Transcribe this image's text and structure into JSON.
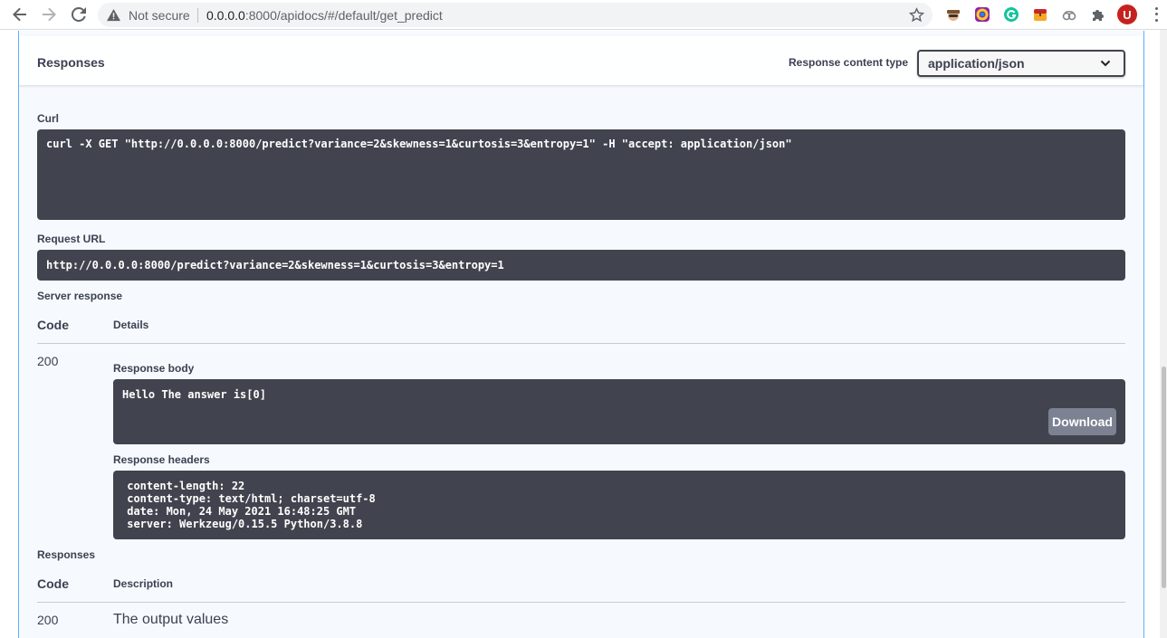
{
  "browser": {
    "security_label": "Not secure",
    "url_host": "0.0.0.0",
    "url_rest": ":8000/apidocs/#/default/get_predict",
    "avatar_letter": "U",
    "extension_icons": [
      "incognito-spy-icon",
      "colorful-circle-icon",
      "grammarly-icon",
      "treasure-chest-icon",
      "cloud-link-icon",
      "puzzle-extensions-icon"
    ]
  },
  "responses_header": {
    "title": "Responses",
    "content_type_label": "Response content type",
    "content_type_value": "application/json"
  },
  "curl": {
    "label": "Curl",
    "command": "curl -X GET \"http://0.0.0.0:8000/predict?variance=2&skewness=1&curtosis=3&entropy=1\" -H \"accept: application/json\""
  },
  "request_url": {
    "label": "Request URL",
    "value": "http://0.0.0.0:8000/predict?variance=2&skewness=1&curtosis=3&entropy=1"
  },
  "server_response": {
    "label": "Server response",
    "col_code": "Code",
    "col_details": "Details",
    "code": "200",
    "body_label": "Response body",
    "body": "Hello The answer is[0]",
    "download_label": "Download",
    "headers_label": "Response headers",
    "headers": " content-length: 22 \n content-type: text/html; charset=utf-8 \n date: Mon, 24 May 2021 16:48:25 GMT \n server: Werkzeug/0.15.5 Python/3.8.8 "
  },
  "responses_table": {
    "label": "Responses",
    "col_code": "Code",
    "col_description": "Description",
    "code": "200",
    "description": "The output values"
  }
}
